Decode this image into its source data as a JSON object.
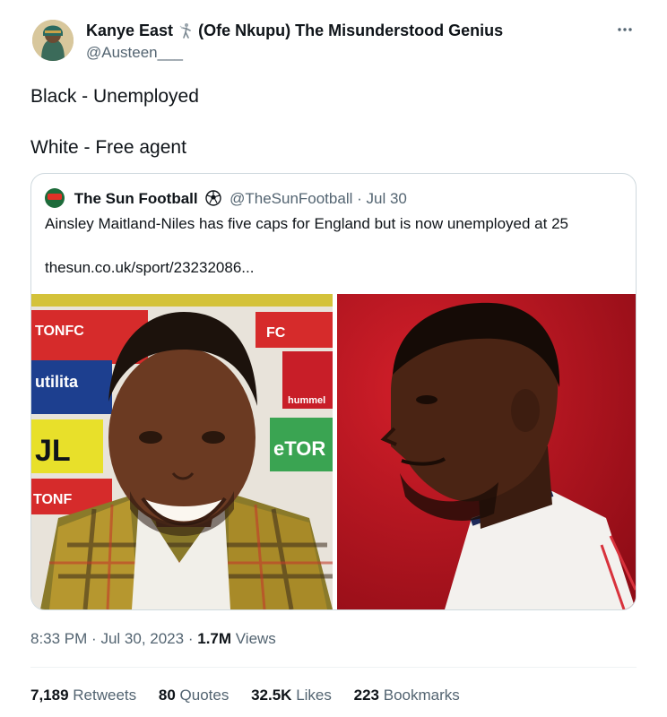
{
  "author": {
    "name": "Kanye East",
    "name_suffix": "(Ofe Nkupu) The Misunderstood Genius",
    "handle": "@Austeen___"
  },
  "more_icon": "more-horizontal-icon",
  "tweet": {
    "line1": "Black - Unemployed",
    "line2": "White - Free agent"
  },
  "quoted": {
    "name": "The Sun Football",
    "handle": "@TheSunFootball",
    "separator": "·",
    "date": "Jul 30",
    "text": "Ainsley Maitland-Niles has five caps for England but is now unemployed at 25",
    "link": "thesun.co.uk/sport/23232086...",
    "photo_left_board": [
      "TONFC",
      "utilita",
      "JL",
      "TONF",
      "FC",
      "hummel",
      "eTOR"
    ],
    "colors": {
      "logo_green": "#1d6b3a",
      "logo_red": "#e03127",
      "photo_right_bg": "#b3141d"
    }
  },
  "meta": {
    "time": "8:33 PM",
    "sep1": "·",
    "date": "Jul 30, 2023",
    "sep2": "·",
    "views_count": "1.7M",
    "views_label": "Views"
  },
  "stats": {
    "retweets_count": "7,189",
    "retweets_label": "Retweets",
    "quotes_count": "80",
    "quotes_label": "Quotes",
    "likes_count": "32.5K",
    "likes_label": "Likes",
    "bookmarks_count": "223",
    "bookmarks_label": "Bookmarks"
  }
}
